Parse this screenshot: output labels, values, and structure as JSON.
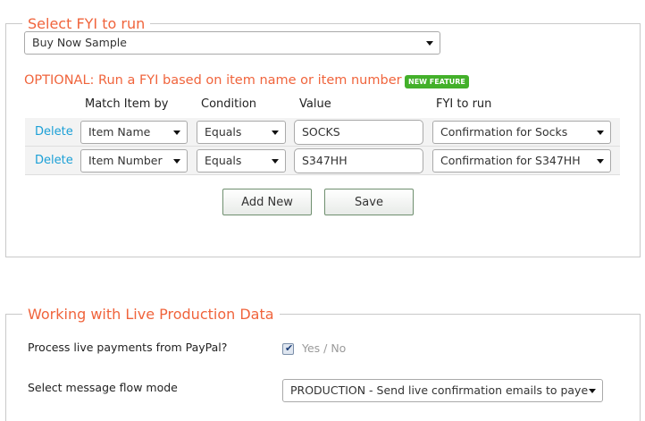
{
  "fyi_section": {
    "legend": "Select FYI to run",
    "selected_fyi": "Buy Now Sample",
    "optional_text": "OPTIONAL: Run a FYI based on item name or item number",
    "badge": "NEW FEATURE",
    "columns": {
      "match_by": "Match Item by",
      "condition": "Condition",
      "value": "Value",
      "fyi_to_run": "FYI to run"
    },
    "rows": [
      {
        "delete": "Delete",
        "match_by": "Item Name",
        "condition": "Equals",
        "value": "SOCKS",
        "fyi": "Confirmation for Socks"
      },
      {
        "delete": "Delete",
        "match_by": "Item Number",
        "condition": "Equals",
        "value": "S347HH",
        "fyi": "Confirmation for S347HH"
      }
    ],
    "add_new_label": "Add New",
    "save_label": "Save"
  },
  "live_section": {
    "legend": "Working with Live Production Data",
    "paypal_label": "Process live payments from PayPal?",
    "paypal_checked": true,
    "paypal_toggle_text": "Yes / No",
    "flow_label": "Select message flow mode",
    "flow_value": "PRODUCTION - Send live confirmation emails to paye"
  },
  "colors": {
    "accent": "#f0643c",
    "link": "#1a9fd6",
    "badge": "#43b02a"
  }
}
